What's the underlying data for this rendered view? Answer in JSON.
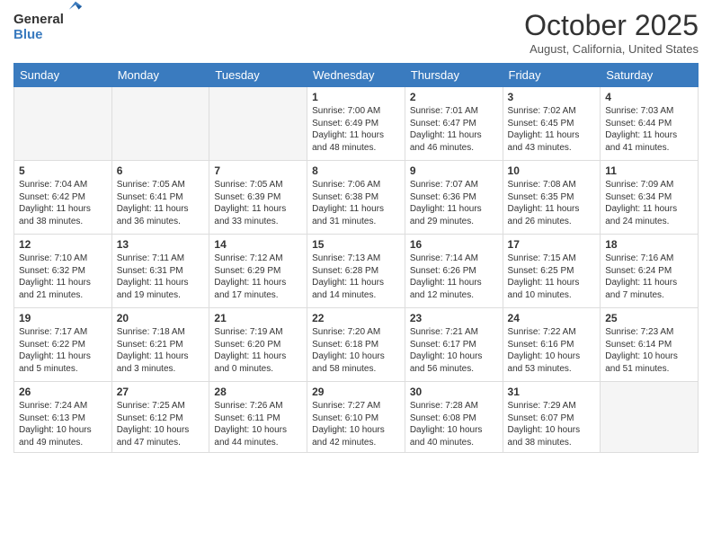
{
  "logo": {
    "general": "General",
    "blue": "Blue"
  },
  "header": {
    "month": "October 2025",
    "subtitle": "August, California, United States"
  },
  "days_of_week": [
    "Sunday",
    "Monday",
    "Tuesday",
    "Wednesday",
    "Thursday",
    "Friday",
    "Saturday"
  ],
  "weeks": [
    [
      {
        "day": "",
        "info": ""
      },
      {
        "day": "",
        "info": ""
      },
      {
        "day": "",
        "info": ""
      },
      {
        "day": "1",
        "info": "Sunrise: 7:00 AM\nSunset: 6:49 PM\nDaylight: 11 hours and 48 minutes."
      },
      {
        "day": "2",
        "info": "Sunrise: 7:01 AM\nSunset: 6:47 PM\nDaylight: 11 hours and 46 minutes."
      },
      {
        "day": "3",
        "info": "Sunrise: 7:02 AM\nSunset: 6:45 PM\nDaylight: 11 hours and 43 minutes."
      },
      {
        "day": "4",
        "info": "Sunrise: 7:03 AM\nSunset: 6:44 PM\nDaylight: 11 hours and 41 minutes."
      }
    ],
    [
      {
        "day": "5",
        "info": "Sunrise: 7:04 AM\nSunset: 6:42 PM\nDaylight: 11 hours and 38 minutes."
      },
      {
        "day": "6",
        "info": "Sunrise: 7:05 AM\nSunset: 6:41 PM\nDaylight: 11 hours and 36 minutes."
      },
      {
        "day": "7",
        "info": "Sunrise: 7:05 AM\nSunset: 6:39 PM\nDaylight: 11 hours and 33 minutes."
      },
      {
        "day": "8",
        "info": "Sunrise: 7:06 AM\nSunset: 6:38 PM\nDaylight: 11 hours and 31 minutes."
      },
      {
        "day": "9",
        "info": "Sunrise: 7:07 AM\nSunset: 6:36 PM\nDaylight: 11 hours and 29 minutes."
      },
      {
        "day": "10",
        "info": "Sunrise: 7:08 AM\nSunset: 6:35 PM\nDaylight: 11 hours and 26 minutes."
      },
      {
        "day": "11",
        "info": "Sunrise: 7:09 AM\nSunset: 6:34 PM\nDaylight: 11 hours and 24 minutes."
      }
    ],
    [
      {
        "day": "12",
        "info": "Sunrise: 7:10 AM\nSunset: 6:32 PM\nDaylight: 11 hours and 21 minutes."
      },
      {
        "day": "13",
        "info": "Sunrise: 7:11 AM\nSunset: 6:31 PM\nDaylight: 11 hours and 19 minutes."
      },
      {
        "day": "14",
        "info": "Sunrise: 7:12 AM\nSunset: 6:29 PM\nDaylight: 11 hours and 17 minutes."
      },
      {
        "day": "15",
        "info": "Sunrise: 7:13 AM\nSunset: 6:28 PM\nDaylight: 11 hours and 14 minutes."
      },
      {
        "day": "16",
        "info": "Sunrise: 7:14 AM\nSunset: 6:26 PM\nDaylight: 11 hours and 12 minutes."
      },
      {
        "day": "17",
        "info": "Sunrise: 7:15 AM\nSunset: 6:25 PM\nDaylight: 11 hours and 10 minutes."
      },
      {
        "day": "18",
        "info": "Sunrise: 7:16 AM\nSunset: 6:24 PM\nDaylight: 11 hours and 7 minutes."
      }
    ],
    [
      {
        "day": "19",
        "info": "Sunrise: 7:17 AM\nSunset: 6:22 PM\nDaylight: 11 hours and 5 minutes."
      },
      {
        "day": "20",
        "info": "Sunrise: 7:18 AM\nSunset: 6:21 PM\nDaylight: 11 hours and 3 minutes."
      },
      {
        "day": "21",
        "info": "Sunrise: 7:19 AM\nSunset: 6:20 PM\nDaylight: 11 hours and 0 minutes."
      },
      {
        "day": "22",
        "info": "Sunrise: 7:20 AM\nSunset: 6:18 PM\nDaylight: 10 hours and 58 minutes."
      },
      {
        "day": "23",
        "info": "Sunrise: 7:21 AM\nSunset: 6:17 PM\nDaylight: 10 hours and 56 minutes."
      },
      {
        "day": "24",
        "info": "Sunrise: 7:22 AM\nSunset: 6:16 PM\nDaylight: 10 hours and 53 minutes."
      },
      {
        "day": "25",
        "info": "Sunrise: 7:23 AM\nSunset: 6:14 PM\nDaylight: 10 hours and 51 minutes."
      }
    ],
    [
      {
        "day": "26",
        "info": "Sunrise: 7:24 AM\nSunset: 6:13 PM\nDaylight: 10 hours and 49 minutes."
      },
      {
        "day": "27",
        "info": "Sunrise: 7:25 AM\nSunset: 6:12 PM\nDaylight: 10 hours and 47 minutes."
      },
      {
        "day": "28",
        "info": "Sunrise: 7:26 AM\nSunset: 6:11 PM\nDaylight: 10 hours and 44 minutes."
      },
      {
        "day": "29",
        "info": "Sunrise: 7:27 AM\nSunset: 6:10 PM\nDaylight: 10 hours and 42 minutes."
      },
      {
        "day": "30",
        "info": "Sunrise: 7:28 AM\nSunset: 6:08 PM\nDaylight: 10 hours and 40 minutes."
      },
      {
        "day": "31",
        "info": "Sunrise: 7:29 AM\nSunset: 6:07 PM\nDaylight: 10 hours and 38 minutes."
      },
      {
        "day": "",
        "info": ""
      }
    ]
  ]
}
